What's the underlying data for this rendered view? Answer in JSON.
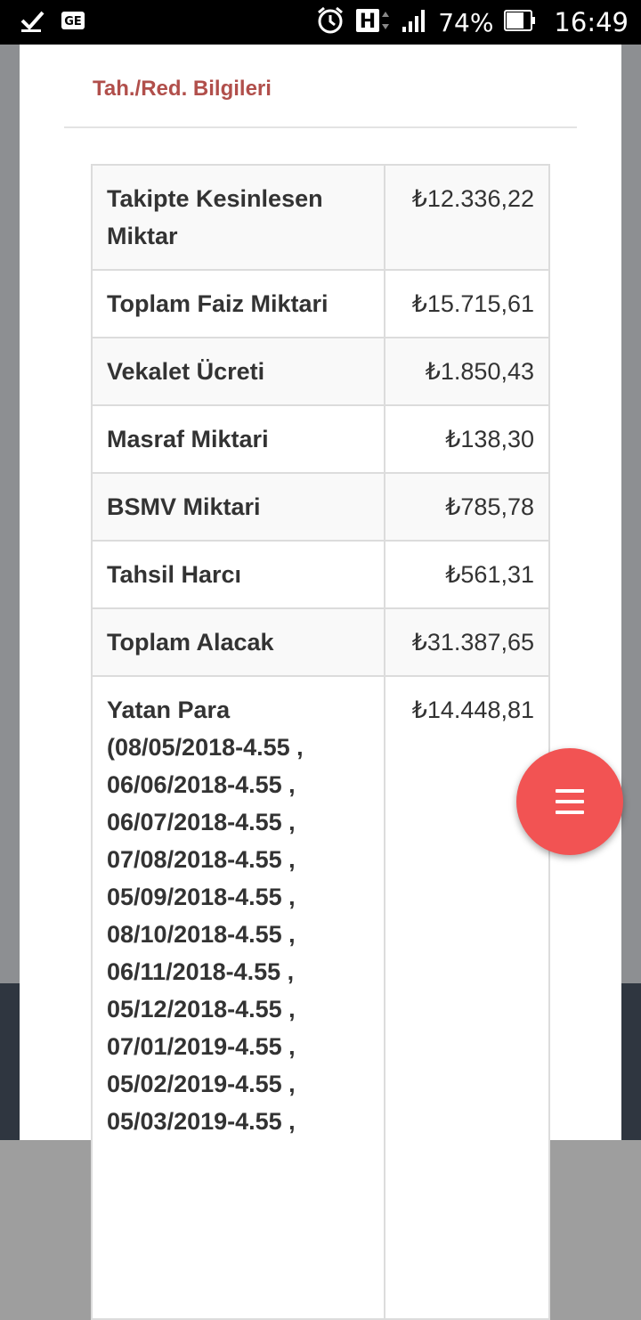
{
  "status_bar": {
    "battery": "74%",
    "network_type": "H",
    "time": "16:49",
    "icons": [
      "check-icon",
      "ge-icon",
      "alarm-icon",
      "signal-icon",
      "battery-icon"
    ]
  },
  "section": {
    "title": "Tah./Red. Bilgileri"
  },
  "table": {
    "rows": [
      {
        "label": "Takipte Kesinlesen Miktar",
        "value": "₺12.336,22"
      },
      {
        "label": "Toplam Faiz Miktari",
        "value": "₺15.715,61"
      },
      {
        "label": "Vekalet Ücreti",
        "value": "₺1.850,43"
      },
      {
        "label": "Masraf Miktari",
        "value": "₺138,30"
      },
      {
        "label": "BSMV Miktari",
        "value": "₺785,78"
      },
      {
        "label": "Tahsil Harcı",
        "value": "₺561,31"
      },
      {
        "label": "Toplam Alacak",
        "value": "₺31.387,65"
      },
      {
        "label": "Yatan Para (08/05/2018-4.55 , 06/06/2018-4.55 , 06/07/2018-4.55 , 07/08/2018-4.55 , 05/09/2018-4.55 , 08/10/2018-4.55 , 06/11/2018-4.55 , 05/12/2018-4.55 , 07/01/2019-4.55 , 05/02/2019-4.55 , 05/03/2019-4.55 ,",
        "value": "₺14.448,81"
      }
    ]
  },
  "fab": {
    "icon": "menu-icon"
  },
  "colors": {
    "section_title": "#b14f4b",
    "fab": "#f25353"
  }
}
